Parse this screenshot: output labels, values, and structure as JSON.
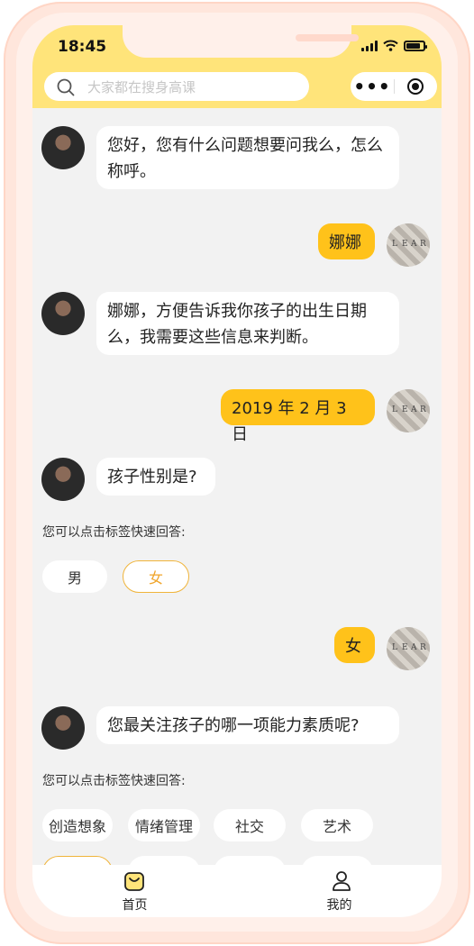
{
  "status_bar": {
    "time": "18:45"
  },
  "search": {
    "placeholder": "大家都在搜身高课"
  },
  "capsule": {
    "more_label": "•••"
  },
  "colors": {
    "accent": "#ffc21a",
    "header": "#ffe47a",
    "chip_selected": "#f0a52b"
  },
  "messages": [
    {
      "from": "bot",
      "text": "您好，您有什么问题想要问我么，怎么称呼。"
    },
    {
      "from": "user",
      "text": "娜娜"
    },
    {
      "from": "bot",
      "text": "娜娜，方便告诉我你孩子的出生日期么，我需要这些信息来判断。"
    },
    {
      "from": "user",
      "text": "2019 年 2 月 3 日"
    },
    {
      "from": "bot",
      "text": "孩子性别是?"
    },
    {
      "from": "user",
      "text": "女"
    },
    {
      "from": "bot",
      "text": "您最关注孩子的哪一项能力素质呢?"
    }
  ],
  "quick_reply_hint": "您可以点击标签快速回答:",
  "gender_options": [
    "男",
    "女"
  ],
  "gender_selected": "女",
  "ability_options": [
    "创造想象",
    "情绪管理",
    "社交",
    "艺术"
  ],
  "user_avatar_letters": [
    "L",
    "E",
    "A",
    "R"
  ],
  "tabbar": {
    "items": [
      {
        "label": "首页",
        "icon": "home-icon"
      },
      {
        "label": "我的",
        "icon": "profile-icon"
      }
    ]
  }
}
